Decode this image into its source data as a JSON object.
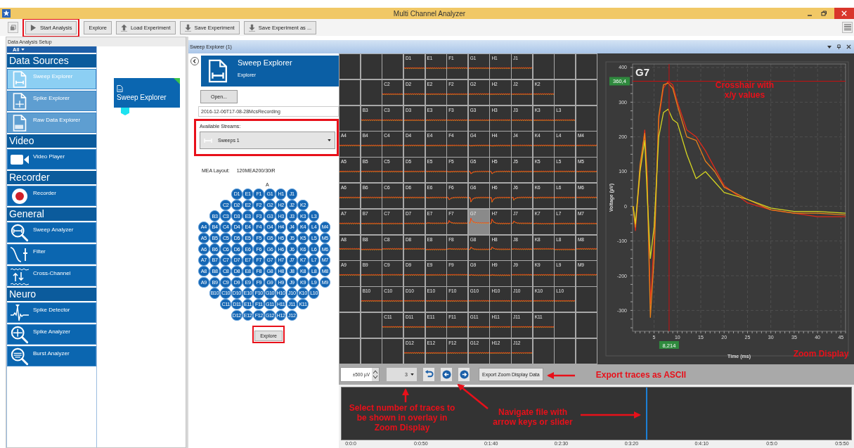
{
  "window": {
    "title": "Multi Channel Analyzer"
  },
  "toolbar": {
    "buttons": [
      {
        "label": "Start Analysis",
        "kind": "play",
        "highlighted": true
      },
      {
        "label": "Explore",
        "kind": "none",
        "highlighted": false
      },
      {
        "label": "Load Experiment",
        "kind": "upload",
        "highlighted": false
      },
      {
        "label": "Save Experiment",
        "kind": "download",
        "highlighted": false
      },
      {
        "label": "Save Experiment as ...",
        "kind": "download",
        "highlighted": false
      }
    ]
  },
  "setup_panel": {
    "title": "Data Analysis Setup",
    "filter": "All",
    "groups": [
      {
        "title": "Data Sources",
        "items": [
          {
            "label": "Sweep Explorer",
            "kind": "sweep-file",
            "selected": true,
            "disabled": false
          },
          {
            "label": "Spike Explorer",
            "kind": "spike-file",
            "selected": false,
            "disabled": true
          },
          {
            "label": "Raw Data Explorer",
            "kind": "raw-file",
            "selected": false,
            "disabled": true
          }
        ]
      },
      {
        "title": "Video",
        "items": [
          {
            "label": "Video Player",
            "kind": "video",
            "selected": false,
            "disabled": false
          }
        ]
      },
      {
        "title": "Recorder",
        "items": [
          {
            "label": "Recorder",
            "kind": "record",
            "selected": false,
            "disabled": false
          }
        ]
      },
      {
        "title": "General",
        "items": [
          {
            "label": "Sweep Analyzer",
            "kind": "sweep-analyzer",
            "selected": false,
            "disabled": false
          },
          {
            "label": "Filter",
            "kind": "filter",
            "selected": false,
            "disabled": false
          },
          {
            "label": "Cross-Channel",
            "kind": "cross-channel",
            "selected": false,
            "disabled": false
          }
        ]
      },
      {
        "title": "Neuro",
        "items": [
          {
            "label": "Spike Detector",
            "kind": "spike-detector",
            "selected": false,
            "disabled": false
          },
          {
            "label": "Spike Analyzer",
            "kind": "spike-analyzer",
            "selected": false,
            "disabled": false
          },
          {
            "label": "Burst Analyzer",
            "kind": "burst-analyzer",
            "selected": false,
            "disabled": false
          }
        ]
      }
    ],
    "canvas_nodes": [
      {
        "label": "Sweep Explorer"
      }
    ]
  },
  "explorer_panel": {
    "title": "Sweep Explorer (1)",
    "header": {
      "title": "Sweep Explorer",
      "subtitle": "Explorer"
    },
    "open_button": "Open...",
    "file_name": "2016-12-06T17-08-28McsRecording",
    "streams": {
      "label": "Available Streams:",
      "value": "Sweeps 1",
      "highlighted": true
    },
    "mea_layout": {
      "label": "MEA Layout:",
      "value": "120MEA200/30iR",
      "column_label": "A",
      "rows": [
        [
          "D1",
          "E1",
          "F1",
          "G1",
          "H1",
          "J1"
        ],
        [
          "C2",
          "D2",
          "E2",
          "F2",
          "G2",
          "H2",
          "J2",
          "K2"
        ],
        [
          "B3",
          "C3",
          "D3",
          "E3",
          "F3",
          "G3",
          "H3",
          "J3",
          "K3",
          "L3"
        ],
        [
          "A4",
          "B4",
          "C4",
          "D4",
          "E4",
          "F4",
          "G4",
          "H4",
          "J4",
          "K4",
          "L4",
          "M4"
        ],
        [
          "A5",
          "B5",
          "C5",
          "D5",
          "E5",
          "F5",
          "G5",
          "H5",
          "J5",
          "K5",
          "L5",
          "M5"
        ],
        [
          "A6",
          "B6",
          "C6",
          "D6",
          "E6",
          "F6",
          "G6",
          "H6",
          "J6",
          "K6",
          "L6",
          "M6"
        ],
        [
          "A7",
          "B7",
          "C7",
          "D7",
          "E7",
          "F7",
          "G7",
          "H7",
          "J7",
          "K7",
          "L7",
          "M7"
        ],
        [
          "A8",
          "B8",
          "C8",
          "D8",
          "E8",
          "F8",
          "G8",
          "H8",
          "J8",
          "K8",
          "L8",
          "M8"
        ],
        [
          "A9",
          "B9",
          "C9",
          "D9",
          "E9",
          "F9",
          "G9",
          "H9",
          "J9",
          "K9",
          "L9",
          "M9"
        ],
        [
          "B10",
          "C10",
          "D10",
          "E10",
          "F10",
          "G10",
          "H10",
          "J10",
          "K10",
          "L10"
        ],
        [
          "C11",
          "D11",
          "E11",
          "F11",
          "G11",
          "H11",
          "J11",
          "K11"
        ],
        [
          "D12",
          "E12",
          "F12",
          "G12",
          "H12",
          "J12"
        ]
      ]
    },
    "explore_button": {
      "label": "Explore",
      "highlighted": true
    }
  },
  "channel_grid": {
    "rows": [
      [
        {
          "label": "D1",
          "selected": false
        },
        {
          "label": "E1",
          "selected": false
        },
        {
          "label": "F1",
          "selected": false
        },
        {
          "label": "G1",
          "selected": false
        },
        {
          "label": "H1",
          "selected": false
        },
        {
          "label": "J1",
          "selected": false
        }
      ],
      [
        {
          "label": "C2",
          "selected": false
        },
        {
          "label": "D2",
          "selected": false
        },
        {
          "label": "E2",
          "selected": false
        },
        {
          "label": "F2",
          "selected": false
        },
        {
          "label": "G2",
          "selected": false
        },
        {
          "label": "H2",
          "selected": false
        },
        {
          "label": "J2",
          "selected": false
        },
        {
          "label": "K2",
          "selected": false
        }
      ],
      [
        {
          "label": "B3",
          "selected": false
        },
        {
          "label": "C3",
          "selected": false
        },
        {
          "label": "D3",
          "selected": false
        },
        {
          "label": "E3",
          "selected": false
        },
        {
          "label": "F3",
          "selected": false
        },
        {
          "label": "G3",
          "selected": false
        },
        {
          "label": "H3",
          "selected": false
        },
        {
          "label": "J3",
          "selected": false
        },
        {
          "label": "K3",
          "selected": false
        },
        {
          "label": "L3",
          "selected": false
        }
      ],
      [
        {
          "label": "A4",
          "selected": false
        },
        {
          "label": "B4",
          "selected": false
        },
        {
          "label": "C4",
          "selected": false
        },
        {
          "label": "D4",
          "selected": false
        },
        {
          "label": "E4",
          "selected": false
        },
        {
          "label": "F4",
          "selected": false
        },
        {
          "label": "G4",
          "selected": false
        },
        {
          "label": "H4",
          "selected": false
        },
        {
          "label": "J4",
          "selected": false
        },
        {
          "label": "K4",
          "selected": false
        },
        {
          "label": "L4",
          "selected": false
        },
        {
          "label": "M4",
          "selected": false
        }
      ],
      [
        {
          "label": "A5",
          "selected": false
        },
        {
          "label": "B5",
          "selected": false
        },
        {
          "label": "C5",
          "selected": false
        },
        {
          "label": "D5",
          "selected": false
        },
        {
          "label": "E5",
          "selected": false
        },
        {
          "label": "F5",
          "selected": false
        },
        {
          "label": "G5",
          "selected": false
        },
        {
          "label": "H5",
          "selected": false
        },
        {
          "label": "J5",
          "selected": false
        },
        {
          "label": "K5",
          "selected": false
        },
        {
          "label": "L5",
          "selected": false
        },
        {
          "label": "M5",
          "selected": false
        }
      ],
      [
        {
          "label": "A6",
          "selected": false
        },
        {
          "label": "B6",
          "selected": false
        },
        {
          "label": "C6",
          "selected": false
        },
        {
          "label": "D6",
          "selected": false
        },
        {
          "label": "E6",
          "selected": false
        },
        {
          "label": "F6",
          "selected": false
        },
        {
          "label": "G6",
          "selected": false
        },
        {
          "label": "H6",
          "selected": false
        },
        {
          "label": "J6",
          "selected": false
        },
        {
          "label": "K6",
          "selected": false
        },
        {
          "label": "L6",
          "selected": false
        },
        {
          "label": "M6",
          "selected": false
        }
      ],
      [
        {
          "label": "A7",
          "selected": false
        },
        {
          "label": "B7",
          "selected": false
        },
        {
          "label": "C7",
          "selected": false
        },
        {
          "label": "D7",
          "selected": false
        },
        {
          "label": "E7",
          "selected": false
        },
        {
          "label": "F7",
          "selected": false
        },
        {
          "label": "G7",
          "selected": true
        },
        {
          "label": "H7",
          "selected": false
        },
        {
          "label": "J7",
          "selected": false
        },
        {
          "label": "K7",
          "selected": false
        },
        {
          "label": "L7",
          "selected": false
        },
        {
          "label": "M7",
          "selected": false
        }
      ],
      [
        {
          "label": "A8",
          "selected": false
        },
        {
          "label": "B8",
          "selected": false
        },
        {
          "label": "C8",
          "selected": false
        },
        {
          "label": "D8",
          "selected": false
        },
        {
          "label": "E8",
          "selected": false
        },
        {
          "label": "F8",
          "selected": false
        },
        {
          "label": "G8",
          "selected": false
        },
        {
          "label": "H8",
          "selected": false
        },
        {
          "label": "J8",
          "selected": false
        },
        {
          "label": "K8",
          "selected": false
        },
        {
          "label": "L8",
          "selected": false
        },
        {
          "label": "M8",
          "selected": false
        }
      ],
      [
        {
          "label": "A9",
          "selected": false
        },
        {
          "label": "B9",
          "selected": false
        },
        {
          "label": "C9",
          "selected": false
        },
        {
          "label": "D9",
          "selected": false
        },
        {
          "label": "E9",
          "selected": false
        },
        {
          "label": "F9",
          "selected": false
        },
        {
          "label": "G9",
          "selected": false
        },
        {
          "label": "H9",
          "selected": false
        },
        {
          "label": "J9",
          "selected": false
        },
        {
          "label": "K9",
          "selected": false
        },
        {
          "label": "L9",
          "selected": false
        },
        {
          "label": "M9",
          "selected": false
        }
      ],
      [
        {
          "label": "B10",
          "selected": false
        },
        {
          "label": "C10",
          "selected": false
        },
        {
          "label": "D10",
          "selected": false
        },
        {
          "label": "E10",
          "selected": false
        },
        {
          "label": "F10",
          "selected": false
        },
        {
          "label": "G10",
          "selected": false
        },
        {
          "label": "H10",
          "selected": false
        },
        {
          "label": "J10",
          "selected": false
        },
        {
          "label": "K10",
          "selected": false
        },
        {
          "label": "L10",
          "selected": false
        }
      ],
      [
        {
          "label": "C11",
          "selected": false
        },
        {
          "label": "D11",
          "selected": false
        },
        {
          "label": "E11",
          "selected": false
        },
        {
          "label": "F11",
          "selected": false
        },
        {
          "label": "G11",
          "selected": false
        },
        {
          "label": "H11",
          "selected": false
        },
        {
          "label": "J11",
          "selected": false
        },
        {
          "label": "K11",
          "selected": false
        }
      ],
      [
        {
          "label": "D12",
          "selected": false
        },
        {
          "label": "E12",
          "selected": false
        },
        {
          "label": "F12",
          "selected": false
        },
        {
          "label": "G12",
          "selected": false
        },
        {
          "label": "H12",
          "selected": false
        },
        {
          "label": "J12",
          "selected": false
        }
      ]
    ]
  },
  "zoom_display": {
    "chart_data": {
      "type": "line",
      "title": "G7",
      "xlabel": "Time (ms)",
      "ylabel": "Voltage (µV)",
      "x": [
        0.5,
        1,
        2,
        3,
        3.5,
        4.2,
        5,
        6,
        7,
        8,
        9,
        10,
        12,
        14,
        16,
        18,
        20,
        25,
        30,
        35,
        40,
        46
      ],
      "series": [
        {
          "color": "#e02818",
          "values": [
            0,
            -70,
            100,
            220,
            100,
            -280,
            -100,
            250,
            340,
            360,
            350,
            300,
            220,
            200,
            160,
            110,
            60,
            10,
            -10,
            -20,
            -30,
            -30
          ]
        },
        {
          "color": "#e8801a",
          "values": [
            0,
            -60,
            120,
            210,
            80,
            -320,
            -150,
            260,
            350,
            355,
            340,
            290,
            200,
            190,
            130,
            100,
            55,
            20,
            -10,
            -20,
            -20,
            -25
          ]
        },
        {
          "color": "#d6d622",
          "values": [
            0,
            -50,
            100,
            190,
            40,
            -150,
            -60,
            200,
            270,
            280,
            250,
            240,
            150,
            80,
            100,
            70,
            40,
            20,
            -5,
            -15,
            -15,
            -20
          ]
        }
      ],
      "xlim": [
        0.4,
        46
      ],
      "ylim": [
        -360,
        410
      ],
      "grid": true,
      "xticks": [
        5,
        10,
        15,
        20,
        25,
        30,
        35,
        40,
        45
      ],
      "yticks": [
        -300,
        -200,
        -100,
        0,
        100,
        200,
        300,
        400
      ],
      "ref_lines": [
        {
          "axis": "x",
          "value": 8.214,
          "label": "8,214",
          "color": "#c81010"
        },
        {
          "axis": "y",
          "value": 360.4,
          "label": "360,4",
          "color": "#c81010"
        }
      ]
    }
  },
  "controls": {
    "range": "±500 µV",
    "trace_count": "3",
    "export_button": "Export Zoom Display Data"
  },
  "timeline": {
    "level": 0.6,
    "ticks": [
      "0:0:0",
      "0:0:50",
      "0:1:40",
      "0:2:30",
      "0:3:20",
      "0:4:10",
      "0:5:0",
      "0:5:50"
    ]
  },
  "callouts": [
    {
      "text": "Crosshair with x/y values"
    },
    {
      "text": "Zoom Display"
    },
    {
      "text": "Export traces as ASCII"
    },
    {
      "text": "Select number of traces to be shown in overlay in Zoom Display"
    },
    {
      "text": "Navigate file with arrow keys or slider"
    }
  ]
}
